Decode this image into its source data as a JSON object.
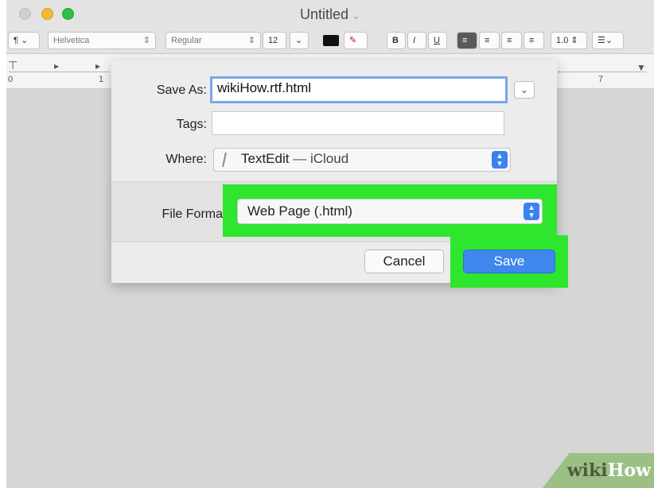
{
  "window": {
    "title": "Untitled"
  },
  "toolbar": {
    "paragraph_style": "¶ ⌄",
    "font_family": "Helvetica",
    "font_style": "Regular",
    "font_size": "12",
    "bold": "B",
    "italic": "I",
    "underline": "U",
    "line_spacing": "1.0",
    "list": "☰⌄"
  },
  "ruler": {
    "ticks": [
      "0",
      "1",
      "7"
    ]
  },
  "save_dialog": {
    "save_as_label": "Save As:",
    "save_as_value": "wikiHow.rtf.html",
    "tags_label": "Tags:",
    "tags_value": "",
    "where_label": "Where:",
    "where_folder": "TextEdit",
    "where_separator": "—",
    "where_location": "iCloud",
    "file_format_label": "File Forma",
    "file_format_value": "Web Page (.html)",
    "cancel_label": "Cancel",
    "save_label": "Save"
  },
  "colors": {
    "highlight": "#2ee62e",
    "save_button": "#3f86ef",
    "popup_arrows": "#3b82f0"
  },
  "watermark": {
    "part1": "wiki",
    "part2": "How"
  }
}
